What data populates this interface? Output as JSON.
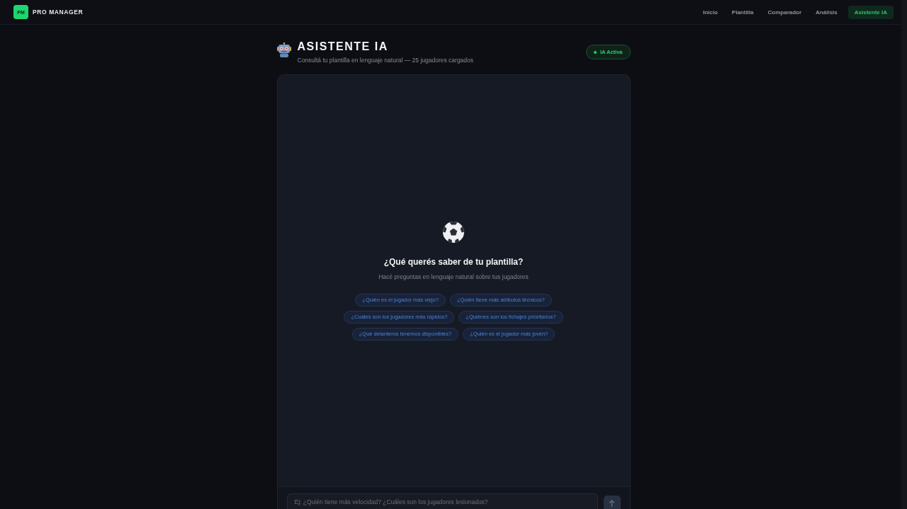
{
  "nav": {
    "logo": {
      "mark": "PM",
      "name": "PRO MANAGER"
    },
    "links": [
      {
        "label": "Inicio",
        "selected": false
      },
      {
        "label": "Plantilla",
        "selected": false
      },
      {
        "label": "Comparador",
        "selected": false
      },
      {
        "label": "Análisis",
        "selected": false
      },
      {
        "label": "Asistente IA",
        "selected": true
      }
    ]
  },
  "header": {
    "title": "ASISTENTE IA",
    "subtitle": "Consultá tu plantilla en lenguaje natural — 25 jugadores cargados",
    "status": {
      "label": "IA Activa",
      "on": true
    }
  },
  "chat": {
    "empty_state": {
      "heading": "¿Qué querés saber de tu plantilla?",
      "hint": "Hacé preguntas en lenguaje natural sobre tus jugadores",
      "suggestions": [
        "¿Quién es el jugador más viejo?",
        "¿Quién tiene más atributos técnicos?",
        "¿Cuáles son los jugadores más rápidos?",
        "¿Quiénes son los fichajes prioritarios?",
        "¿Qué delanteros tenemos disponibles?",
        "¿Quién es el jugador más joven?"
      ]
    },
    "composer": {
      "placeholder": "Ej: ¿Quién tiene más velocidad? ¿Cuáles son los jugadores lesionados?",
      "send_disabled": true
    }
  }
}
